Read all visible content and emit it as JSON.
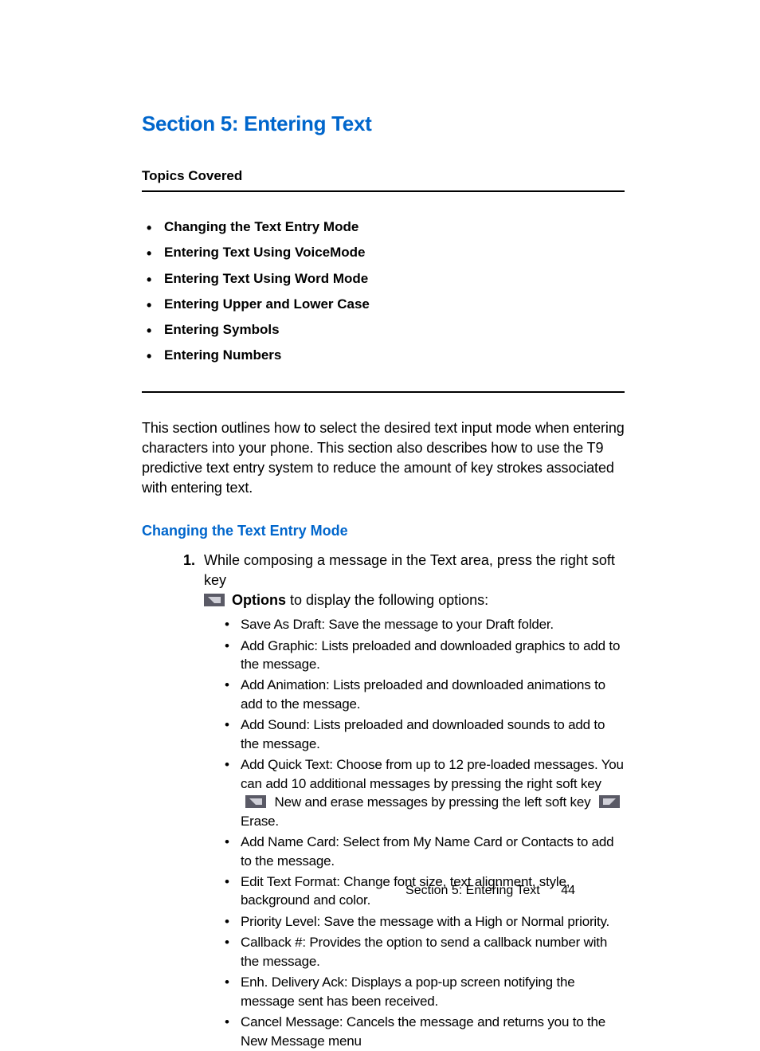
{
  "section_title": "Section 5: Entering Text",
  "topics_heading": "Topics Covered",
  "topics": [
    "Changing the Text Entry Mode",
    "Entering Text Using VoiceMode",
    "Entering Text Using Word Mode",
    "Entering Upper and Lower Case",
    "Entering Symbols",
    "Entering Numbers"
  ],
  "intro": "This section outlines how to select the desired text input mode when entering characters into your phone. This section also describes how to use the T9 predictive text entry system to reduce the amount of key strokes associated with entering text.",
  "subheading": "Changing the Text Entry Mode",
  "step1": {
    "num": "1.",
    "line1": "While composing a message in the Text area, press the right soft key",
    "options": "Options",
    "line1_tail": " to display the following options:"
  },
  "bullets": {
    "b0": "Save As Draft: Save the message to your Draft folder.",
    "b1": "Add Graphic: Lists preloaded and downloaded graphics to add to the message.",
    "b2": "Add Animation: Lists preloaded and downloaded animations to add to the message.",
    "b3": "Add Sound: Lists preloaded and downloaded sounds to add to the message.",
    "b4_a": "Add Quick Text: Choose from up to 12 pre-loaded messages. You can add 10 additional messages by pressing the right soft key ",
    "b4_b": " New and erase messages by pressing the left soft key ",
    "b4_c": " Erase.",
    "b5": "Add Name Card: Select from My Name Card or Contacts to add to the message.",
    "b6": "Edit Text Format: Change font size, text alignment, style, background and color.",
    "b7": "Priority Level: Save the message with a High or Normal priority.",
    "b8": "Callback #: Provides the option to send a callback number with the message.",
    "b9": "Enh. Delivery Ack: Displays a pop-up screen notifying the message sent has been received.",
    "b10": "Cancel Message: Cancels the message and returns you to the New Message menu"
  },
  "footer_text": "Section 5: Entering Text",
  "page_number": "44"
}
